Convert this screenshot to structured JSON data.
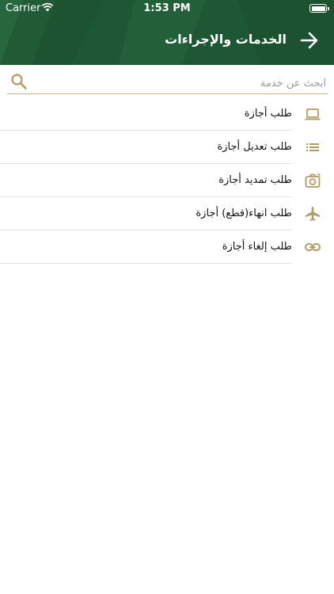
{
  "status_bar": {
    "carrier": "Carrier",
    "time": "1:53 PM"
  },
  "header": {
    "title": "الخدمات والإجراءات",
    "back_icon": "arrow-right-icon",
    "background_color": "#1f5a35"
  },
  "search": {
    "placeholder": "ابحث عن خدمة",
    "value": "",
    "icon": "search-icon"
  },
  "services": [
    {
      "label": "طلب أجازة",
      "icon": "laptop-icon"
    },
    {
      "label": "طلب تعديل أجازة",
      "icon": "list-icon"
    },
    {
      "label": "طلب تمديد أجازة",
      "icon": "camera-rotate-icon"
    },
    {
      "label": "طلب انهاء(قطع) أجازة",
      "icon": "airplane-icon"
    },
    {
      "label": "طلب إلغاء أجازة",
      "icon": "link-icon"
    }
  ],
  "colors": {
    "accent_gold": "#b39a63",
    "separator": "#e3e3e3"
  }
}
